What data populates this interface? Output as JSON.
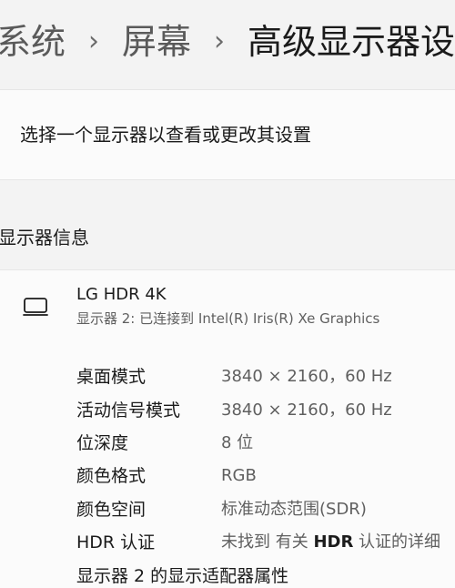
{
  "breadcrumb": {
    "items": [
      "系统",
      "屏幕",
      "高级显示器设"
    ],
    "separator": "›"
  },
  "select_display": {
    "text": "选择一个显示器以查看或更改其设置"
  },
  "display_info": {
    "section_title": "显示器信息",
    "icon": "monitor-icon",
    "name": "LG HDR 4K",
    "subtitle": "显示器 2: 已连接到 Intel(R) Iris(R) Xe Graphics",
    "properties": [
      {
        "label": "桌面模式",
        "value": "3840 × 2160，60 Hz"
      },
      {
        "label": "活动信号模式",
        "value": "3840 × 2160，60 Hz"
      },
      {
        "label": "位深度",
        "value": "8 位"
      },
      {
        "label": "颜色格式",
        "value": "RGB"
      },
      {
        "label": "颜色空间",
        "value": "标准动态范围(SDR)"
      },
      {
        "label": "HDR 认证",
        "value_prefix": "未找到 有关 ",
        "value_strong": "HDR",
        "value_suffix": " 认证的详细"
      }
    ],
    "adapter_link": "显示器 2 的显示适配器属性"
  }
}
